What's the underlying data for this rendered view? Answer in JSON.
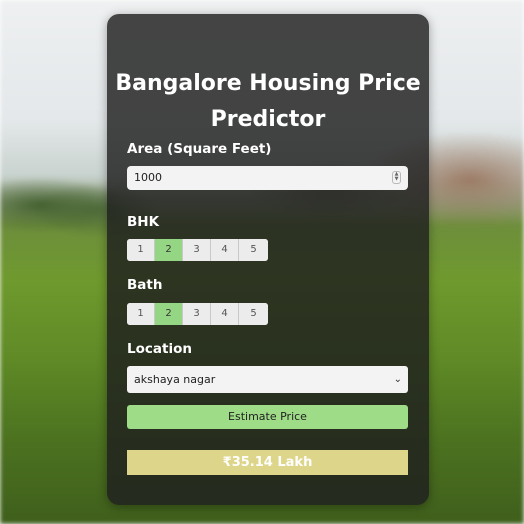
{
  "header": {
    "title": "Bangalore Housing Price Predictor"
  },
  "form": {
    "area_label": "Area (Square Feet)",
    "area_value": "1000",
    "bhk_label": "BHK",
    "bhk_options": [
      "1",
      "2",
      "3",
      "4",
      "5"
    ],
    "bhk_selected": "2",
    "bath_label": "Bath",
    "bath_options": [
      "1",
      "2",
      "3",
      "4",
      "5"
    ],
    "bath_selected": "2",
    "location_label": "Location",
    "location_value": "akshaya nagar",
    "estimate_button": "Estimate Price"
  },
  "result": {
    "text": "₹35.14 Lakh"
  },
  "colors": {
    "card_bg": "rgba(30,30,30,0.82)",
    "active_option": "#95d685",
    "button": "#9fdc88",
    "result_bg": "#ddd68a"
  }
}
